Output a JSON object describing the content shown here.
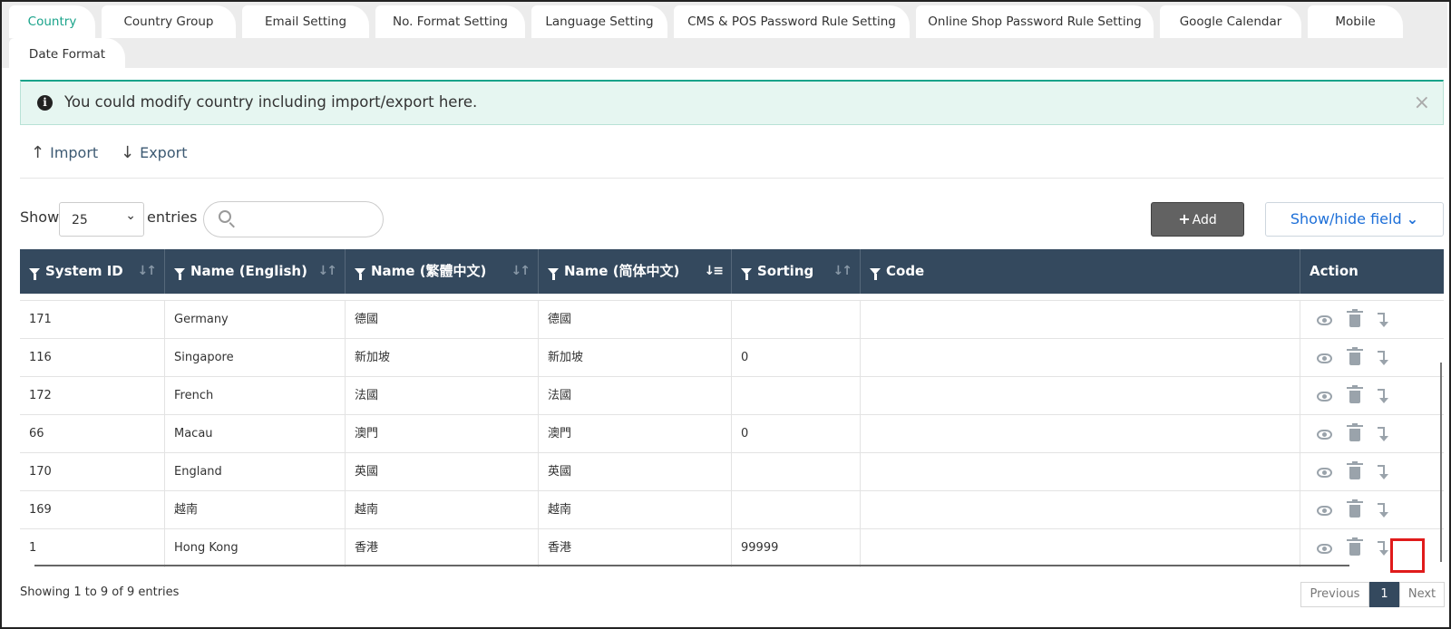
{
  "tabs": [
    {
      "label": "Country",
      "active": true
    },
    {
      "label": "Country Group"
    },
    {
      "label": "Email Setting"
    },
    {
      "label": "No. Format Setting"
    },
    {
      "label": "Language Setting"
    },
    {
      "label": "CMS & POS Password Rule Setting"
    },
    {
      "label": "Online Shop Password Rule Setting"
    },
    {
      "label": "Google Calendar"
    },
    {
      "label": "Mobile"
    },
    {
      "label": "Date Format"
    }
  ],
  "alert": {
    "message": "You could modify country including import/export here.",
    "close_symbol": "×"
  },
  "toolbar": {
    "import_label": "Import",
    "export_label": "Export"
  },
  "controls": {
    "show_label": "Show",
    "entries_value": "25",
    "entries_label": "entries",
    "search_placeholder": "",
    "add_label": "Add",
    "showhide_label": "Show/hide field"
  },
  "table": {
    "columns": [
      "System ID",
      "Name (English)",
      "Name (繁體中文)",
      "Name (简体中文)",
      "Sorting",
      "Code",
      "Action"
    ],
    "rows": [
      {
        "id": "171",
        "name_en": "Germany",
        "name_tc": "德國",
        "name_sc": "德國",
        "sorting": "",
        "code": ""
      },
      {
        "id": "116",
        "name_en": "Singapore",
        "name_tc": "新加坡",
        "name_sc": "新加坡",
        "sorting": "0",
        "code": ""
      },
      {
        "id": "172",
        "name_en": "French",
        "name_tc": "法國",
        "name_sc": "法國",
        "sorting": "",
        "code": ""
      },
      {
        "id": "66",
        "name_en": "Macau",
        "name_tc": "澳門",
        "name_sc": "澳門",
        "sorting": "0",
        "code": ""
      },
      {
        "id": "170",
        "name_en": "England",
        "name_tc": "英國",
        "name_sc": "英國",
        "sorting": "",
        "code": ""
      },
      {
        "id": "169",
        "name_en": "越南",
        "name_tc": "越南",
        "name_sc": "越南",
        "sorting": "",
        "code": ""
      },
      {
        "id": "1",
        "name_en": "Hong Kong",
        "name_tc": "香港",
        "name_sc": "香港",
        "sorting": "99999",
        "code": ""
      }
    ]
  },
  "footer": {
    "info": "Showing 1 to 9 of 9 entries",
    "previous": "Previous",
    "current_page": "1",
    "next": "Next"
  },
  "colors": {
    "accent": "#19a38a",
    "header": "#34495e",
    "link": "#1d6fd8",
    "highlight": "#e01b1b"
  }
}
